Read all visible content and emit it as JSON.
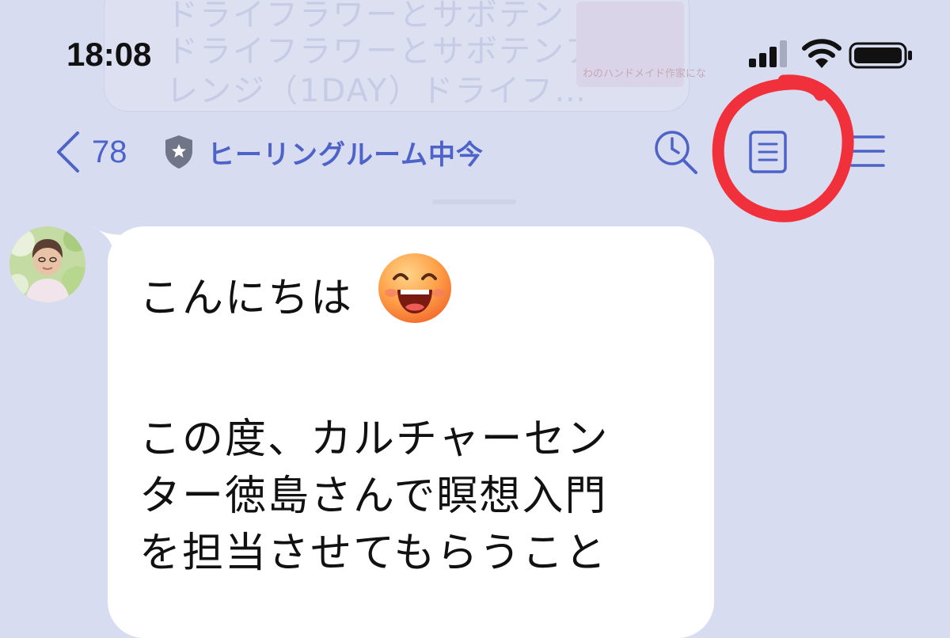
{
  "status_bar": {
    "time": "18:08"
  },
  "background_notification": {
    "title_line": "ドライフラワーとサボテン",
    "body_line1": "ドライフラワーとサボテンア",
    "body_line2": "レンジ（1DAY）ドライフ…",
    "thumb_caption": "わのハンドメイド作家にな"
  },
  "header": {
    "back_count": "78",
    "chat_title": "ヒーリングルーム中今",
    "icons": [
      "back-chevron-icon",
      "official-shield-star-icon",
      "search-history-icon",
      "notes-icon",
      "menu-icon"
    ]
  },
  "message": {
    "line1": "こんにちは",
    "emoji": "grinning-face-emoji",
    "line2": "",
    "line3": "この度、カルチャーセン",
    "line4": "ター徳島さんで瞑想入門",
    "line5": "を担当させてもらうこと"
  },
  "annotation": {
    "color": "#f0303a",
    "target": "notes-icon"
  },
  "colors": {
    "background": "#d8dcf0",
    "accent": "#4e63c8",
    "bubble": "#ffffff"
  }
}
